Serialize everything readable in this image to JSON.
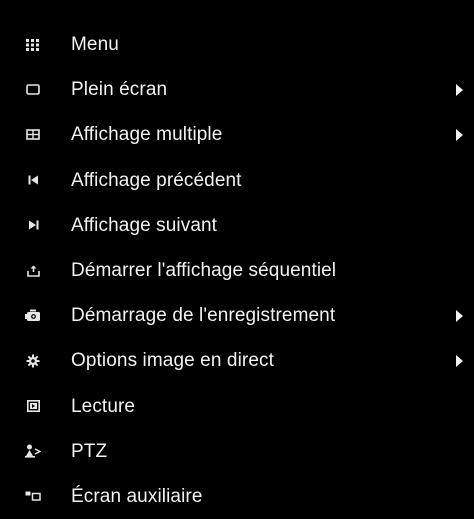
{
  "menu": {
    "background_color": "#000000",
    "text_color": "#f2f2f2",
    "items": [
      {
        "label": "Menu",
        "icon": "grid-icon",
        "has_submenu": false
      },
      {
        "label": "Plein écran",
        "icon": "single-screen-icon",
        "has_submenu": true
      },
      {
        "label": "Affichage multiple",
        "icon": "multi-screen-icon",
        "has_submenu": true
      },
      {
        "label": "Affichage précédent",
        "icon": "previous-icon",
        "has_submenu": false
      },
      {
        "label": "Affichage suivant",
        "icon": "next-icon",
        "has_submenu": false
      },
      {
        "label": "Démarrer l'affichage séquentiel",
        "icon": "sequence-icon",
        "has_submenu": false
      },
      {
        "label": "Démarrage de l'enregistrement",
        "icon": "record-icon",
        "has_submenu": true
      },
      {
        "label": "Options image en direct",
        "icon": "gear-icon",
        "has_submenu": true
      },
      {
        "label": "Lecture",
        "icon": "playback-icon",
        "has_submenu": false
      },
      {
        "label": "PTZ",
        "icon": "ptz-icon",
        "has_submenu": false
      },
      {
        "label": "Écran auxiliaire",
        "icon": "aux-screen-icon",
        "has_submenu": false
      }
    ]
  }
}
